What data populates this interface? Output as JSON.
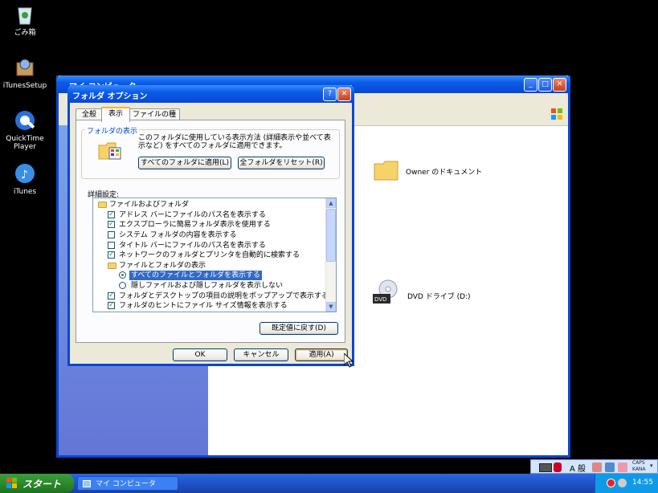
{
  "desktop": {
    "icons": [
      {
        "label": "ごみ箱",
        "icon": "recycle-bin-icon"
      },
      {
        "label": "iTunesSetup",
        "icon": "installer-icon"
      },
      {
        "label": "QuickTime Player",
        "icon": "quicktime-icon"
      },
      {
        "label": "iTunes",
        "icon": "itunes-icon"
      }
    ]
  },
  "explorer": {
    "title": "マイ コンピュータ",
    "items": [
      {
        "label": "Owner のドキュメント",
        "icon": "folder-icon"
      },
      {
        "label": "DVD ドライブ (D:)",
        "icon": "dvd-drive-icon"
      }
    ]
  },
  "dialog": {
    "title": "フォルダ オプション",
    "tabs": [
      "全般",
      "表示",
      "ファイルの種類"
    ],
    "active_tab": "表示",
    "folder_views": {
      "legend": "フォルダの表示",
      "description": "このフォルダに使用している表示方法 (詳細表示や並べて表示など) をすべてのフォルダに適用できます。",
      "apply_all": "すべてのフォルダに適用(L)",
      "reset_all": "全フォルダをリセット(R)"
    },
    "advanced_label": "詳細設定:",
    "advanced_items": [
      {
        "type": "folder",
        "text": "ファイルおよびフォルダ"
      },
      {
        "type": "check",
        "checked": true,
        "text": "アドレス バーにファイルのパス名を表示する"
      },
      {
        "type": "check",
        "checked": true,
        "text": "エクスプローラに簡易フォルダ表示を使用する"
      },
      {
        "type": "check",
        "checked": false,
        "text": "システム フォルダの内容を表示する"
      },
      {
        "type": "check",
        "checked": false,
        "text": "タイトル バーにファイルのパス名を表示する"
      },
      {
        "type": "check",
        "checked": true,
        "text": "ネットワークのフォルダとプリンタを自動的に検索する"
      },
      {
        "type": "folder",
        "text": "ファイルとフォルダの表示"
      },
      {
        "type": "radio",
        "checked": true,
        "text": "すべてのファイルとフォルダを表示する",
        "selected": true
      },
      {
        "type": "radio",
        "checked": false,
        "text": "隠しファイルおよび隠しフォルダを表示しない"
      },
      {
        "type": "check",
        "checked": true,
        "text": "フォルダとデスクトップの項目の説明をポップアップで表示する"
      },
      {
        "type": "check",
        "checked": true,
        "text": "フォルダのヒントにファイル サイズ情報を表示する"
      }
    ],
    "restore_defaults": "既定値に戻す(D)",
    "ok": "OK",
    "cancel": "キャンセル",
    "apply": "適用(A)"
  },
  "taskbar": {
    "start_label": "スタート",
    "task_button": "マイ コンピュータ",
    "clock": "14:55",
    "ime_mode": "A 般",
    "caps": "CAPS",
    "kana": "KANA"
  },
  "colors": {
    "title_blue": "#0a46d6",
    "dialog_bg": "#ece9d8",
    "selection": "#316ac5",
    "start_green": "#2c8a2c"
  }
}
